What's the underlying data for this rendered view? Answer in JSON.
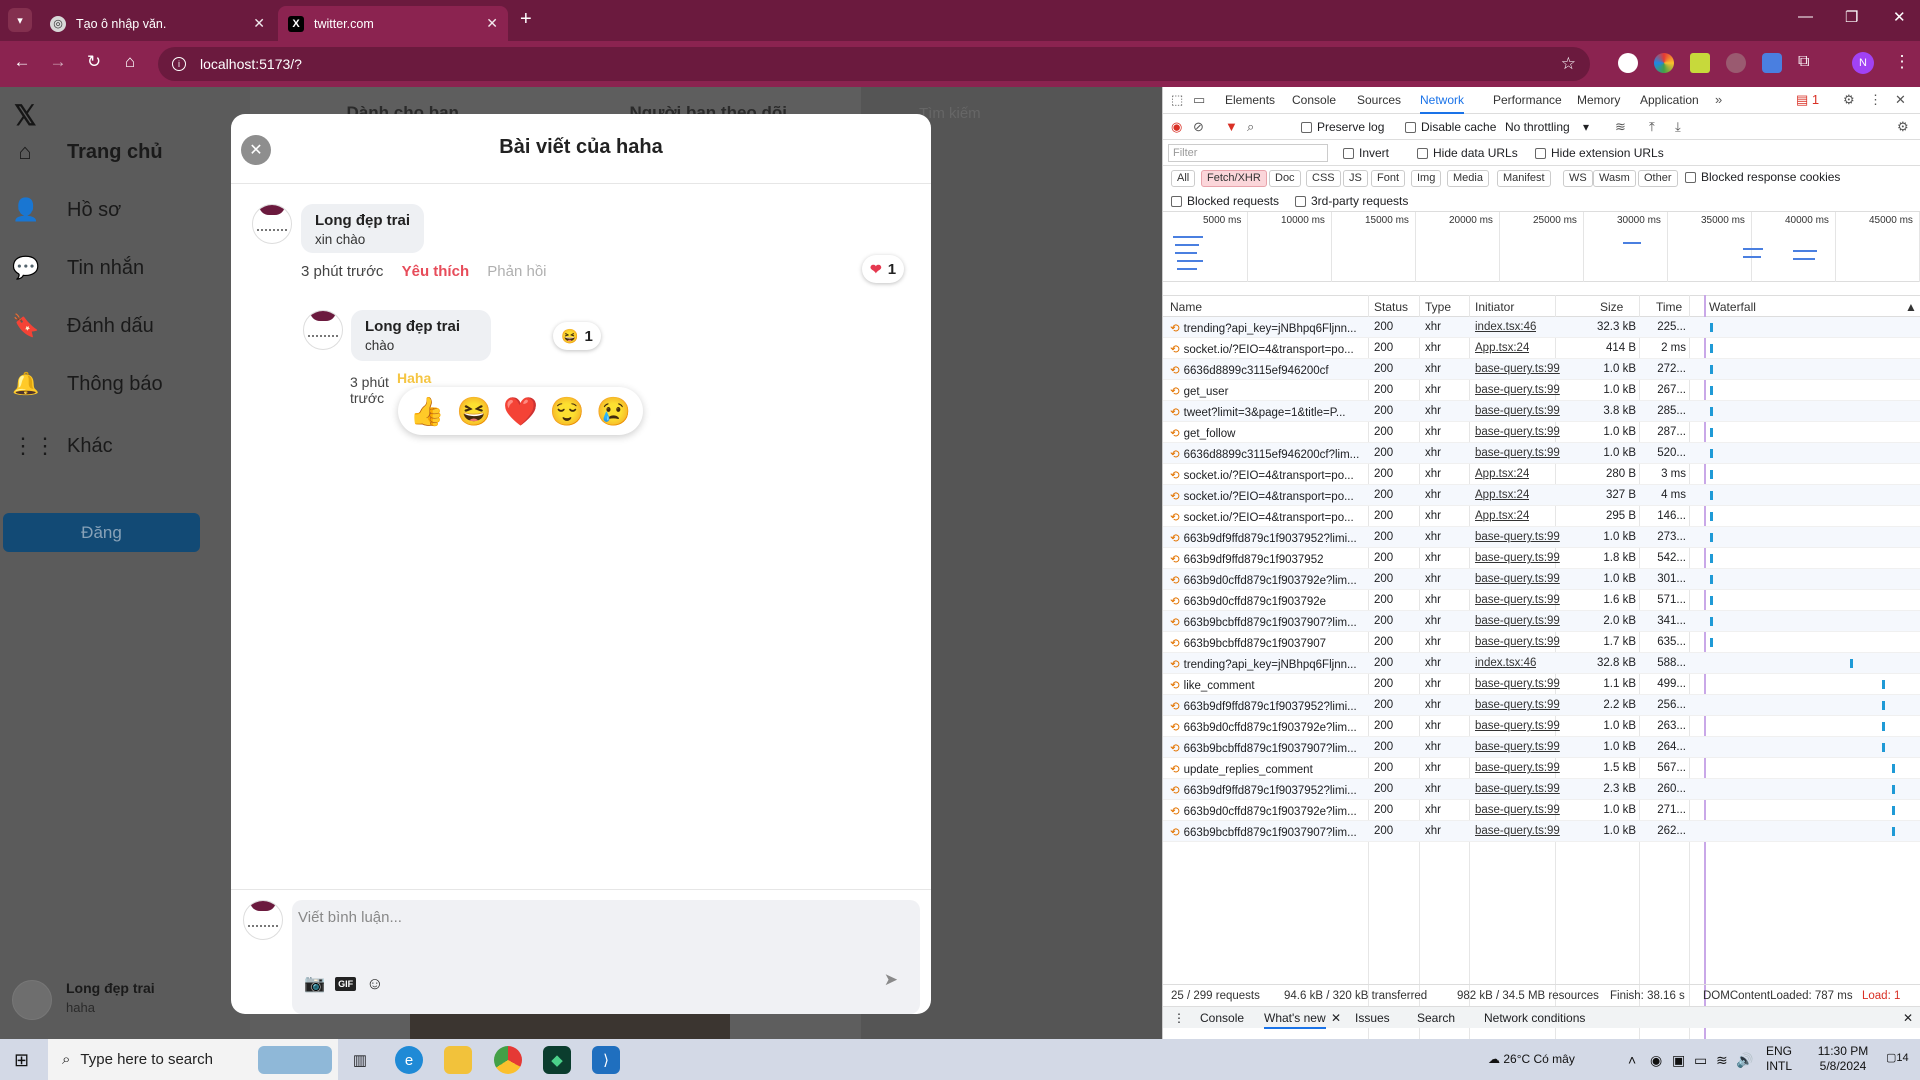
{
  "browser": {
    "tabs": [
      {
        "title": "Tạo ô nhập văn.",
        "favicon": "chatgpt-icon"
      },
      {
        "title": "twitter.com",
        "favicon": "x-logo-icon"
      }
    ],
    "url": "localhost:5173/?",
    "profile_initial": "N",
    "theme_color": "#8b2350"
  },
  "app": {
    "logo": "𝕏",
    "nav": [
      {
        "label": "Trang chủ",
        "icon": "home-icon",
        "glyph": "⌂"
      },
      {
        "label": "Hồ sơ",
        "icon": "user-icon",
        "glyph": "👤"
      },
      {
        "label": "Tin nhắn",
        "icon": "message-icon",
        "glyph": "💬"
      },
      {
        "label": "Đánh dấu",
        "icon": "bookmark-icon",
        "glyph": "🔖"
      },
      {
        "label": "Thông báo",
        "icon": "bell-icon",
        "glyph": "🔔"
      },
      {
        "label": "Khác",
        "icon": "more-grid-icon",
        "glyph": "⋮⋮"
      }
    ],
    "post_button": "Đăng",
    "feed_tabs": [
      "Dành cho bạn",
      "Người bạn theo dõi"
    ],
    "search_placeholder": "Tìm kiếm",
    "current_user": {
      "name": "Long đẹp trai",
      "handle": "haha"
    }
  },
  "modal": {
    "title": "Bài viết của haha",
    "comment": {
      "author": "Long đẹp trai",
      "text": "xin chào",
      "time": "3 phút trước",
      "like_label": "Yêu thích",
      "reply_label": "Phản hồi",
      "reaction_icon": "❤",
      "reaction_count": "1"
    },
    "reply": {
      "author": "Long đẹp trai",
      "text": "chào",
      "time": "3 phút trước",
      "reaction_icon": "😆",
      "reaction_count": "1"
    },
    "picker": {
      "hover_label": "Haha",
      "reactions": [
        "👍",
        "😆",
        "❤️",
        "😌",
        "😢"
      ]
    },
    "composer": {
      "placeholder": "Viết bình luận..."
    }
  },
  "devtools": {
    "tabs": [
      "Elements",
      "Console",
      "Sources",
      "Network",
      "Performance",
      "Memory",
      "Application"
    ],
    "issues_count": "1",
    "options": {
      "preserve_log": "Preserve log",
      "disable_cache": "Disable cache",
      "throttle": "No throttling"
    },
    "filter_placeholder": "Filter",
    "filter_opts": [
      "Invert",
      "Hide data URLs",
      "Hide extension URLs"
    ],
    "type_chips": [
      "All",
      "Fetch/XHR",
      "Doc",
      "CSS",
      "JS",
      "Font",
      "Img",
      "Media",
      "Manifest",
      "WS",
      "Wasm",
      "Other"
    ],
    "blocked_cookies": "Blocked response cookies",
    "blocked_requests": "Blocked requests",
    "third_party": "3rd-party requests",
    "timeline_ticks": [
      "5000 ms",
      "10000 ms",
      "15000 ms",
      "20000 ms",
      "25000 ms",
      "30000 ms",
      "35000 ms",
      "40000 ms",
      "45000 ms"
    ],
    "columns": [
      "Name",
      "Status",
      "Type",
      "Initiator",
      "Size",
      "Time",
      "Waterfall"
    ],
    "requests": [
      {
        "name": "trending?api_key=jNBhpq6Fljnn...",
        "status": "200",
        "type": "xhr",
        "initiator": "index.tsx:46",
        "size": "32.3 kB",
        "time": "225..."
      },
      {
        "name": "socket.io/?EIO=4&transport=po...",
        "status": "200",
        "type": "xhr",
        "initiator": "App.tsx:24",
        "size": "414 B",
        "time": "2 ms"
      },
      {
        "name": "6636d8899c3115ef946200cf",
        "status": "200",
        "type": "xhr",
        "initiator": "base-query.ts:99",
        "size": "1.0 kB",
        "time": "272..."
      },
      {
        "name": "get_user",
        "status": "200",
        "type": "xhr",
        "initiator": "base-query.ts:99",
        "size": "1.0 kB",
        "time": "267..."
      },
      {
        "name": "tweet?limit=3&page=1&title=P...",
        "status": "200",
        "type": "xhr",
        "initiator": "base-query.ts:99",
        "size": "3.8 kB",
        "time": "285..."
      },
      {
        "name": "get_follow",
        "status": "200",
        "type": "xhr",
        "initiator": "base-query.ts:99",
        "size": "1.0 kB",
        "time": "287..."
      },
      {
        "name": "6636d8899c3115ef946200cf?lim...",
        "status": "200",
        "type": "xhr",
        "initiator": "base-query.ts:99",
        "size": "1.0 kB",
        "time": "520..."
      },
      {
        "name": "socket.io/?EIO=4&transport=po...",
        "status": "200",
        "type": "xhr",
        "initiator": "App.tsx:24",
        "size": "280 B",
        "time": "3 ms"
      },
      {
        "name": "socket.io/?EIO=4&transport=po...",
        "status": "200",
        "type": "xhr",
        "initiator": "App.tsx:24",
        "size": "327 B",
        "time": "4 ms"
      },
      {
        "name": "socket.io/?EIO=4&transport=po...",
        "status": "200",
        "type": "xhr",
        "initiator": "App.tsx:24",
        "size": "295 B",
        "time": "146..."
      },
      {
        "name": "663b9df9ffd879c1f9037952?limi...",
        "status": "200",
        "type": "xhr",
        "initiator": "base-query.ts:99",
        "size": "1.0 kB",
        "time": "273..."
      },
      {
        "name": "663b9df9ffd879c1f9037952",
        "status": "200",
        "type": "xhr",
        "initiator": "base-query.ts:99",
        "size": "1.8 kB",
        "time": "542..."
      },
      {
        "name": "663b9d0cffd879c1f903792e?lim...",
        "status": "200",
        "type": "xhr",
        "initiator": "base-query.ts:99",
        "size": "1.0 kB",
        "time": "301..."
      },
      {
        "name": "663b9d0cffd879c1f903792e",
        "status": "200",
        "type": "xhr",
        "initiator": "base-query.ts:99",
        "size": "1.6 kB",
        "time": "571..."
      },
      {
        "name": "663b9bcbffd879c1f9037907?lim...",
        "status": "200",
        "type": "xhr",
        "initiator": "base-query.ts:99",
        "size": "2.0 kB",
        "time": "341..."
      },
      {
        "name": "663b9bcbffd879c1f9037907",
        "status": "200",
        "type": "xhr",
        "initiator": "base-query.ts:99",
        "size": "1.7 kB",
        "time": "635..."
      },
      {
        "name": "trending?api_key=jNBhpq6Fljnn...",
        "status": "200",
        "type": "xhr",
        "initiator": "index.tsx:46",
        "size": "32.8 kB",
        "time": "588..."
      },
      {
        "name": "like_comment",
        "status": "200",
        "type": "xhr",
        "initiator": "base-query.ts:99",
        "size": "1.1 kB",
        "time": "499..."
      },
      {
        "name": "663b9df9ffd879c1f9037952?limi...",
        "status": "200",
        "type": "xhr",
        "initiator": "base-query.ts:99",
        "size": "2.2 kB",
        "time": "256..."
      },
      {
        "name": "663b9d0cffd879c1f903792e?lim...",
        "status": "200",
        "type": "xhr",
        "initiator": "base-query.ts:99",
        "size": "1.0 kB",
        "time": "263..."
      },
      {
        "name": "663b9bcbffd879c1f9037907?lim...",
        "status": "200",
        "type": "xhr",
        "initiator": "base-query.ts:99",
        "size": "1.0 kB",
        "time": "264..."
      },
      {
        "name": "update_replies_comment",
        "status": "200",
        "type": "xhr",
        "initiator": "base-query.ts:99",
        "size": "1.5 kB",
        "time": "567..."
      },
      {
        "name": "663b9df9ffd879c1f9037952?limi...",
        "status": "200",
        "type": "xhr",
        "initiator": "base-query.ts:99",
        "size": "2.3 kB",
        "time": "260..."
      },
      {
        "name": "663b9d0cffd879c1f903792e?lim...",
        "status": "200",
        "type": "xhr",
        "initiator": "base-query.ts:99",
        "size": "1.0 kB",
        "time": "271..."
      },
      {
        "name": "663b9bcbffd879c1f9037907?lim...",
        "status": "200",
        "type": "xhr",
        "initiator": "base-query.ts:99",
        "size": "1.0 kB",
        "time": "262..."
      }
    ],
    "status": {
      "requests": "25 / 299 requests",
      "transferred": "94.6 kB / 320 kB transferred",
      "resources": "982 kB / 34.5 MB resources",
      "finish": "Finish: 38.16 s",
      "dcl": "DOMContentLoaded: 787 ms",
      "load": "Load: 1"
    },
    "drawer_tabs": [
      "Console",
      "What's new",
      "Issues",
      "Search",
      "Network conditions"
    ]
  },
  "taskbar": {
    "search_placeholder": "Type here to search",
    "weather": "26°C  Có mây",
    "lang": "ENG",
    "layout": "INTL",
    "time": "11:30 PM",
    "date": "5/8/2024",
    "notifications": "14"
  }
}
